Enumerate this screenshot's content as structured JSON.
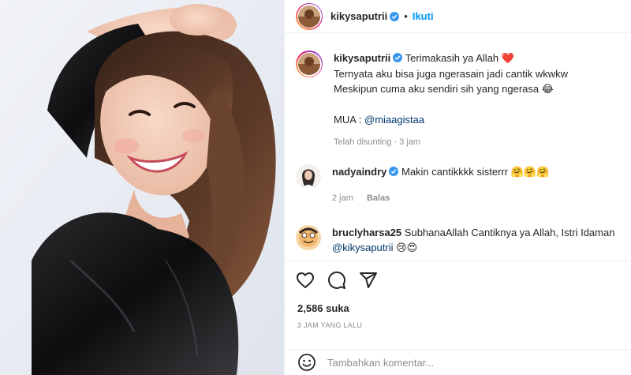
{
  "colors": {
    "accent": "#0095f6",
    "verified": "#3897f0",
    "muted": "#8e8e8e",
    "mention": "#00376b"
  },
  "photo": {
    "subject": "woman smiling in black satin top"
  },
  "header": {
    "username": "kikysaputrii",
    "separator": "•",
    "follow_label": "Ikuti"
  },
  "caption": {
    "username": "kikysaputrii",
    "line1": "Terimakasih ya Allah",
    "line1_emoji": "❤️",
    "line2": "Ternyata aku bisa juga ngerasain jadi cantik wkwkw",
    "line3": "Meskipun cuma aku sendiri sih yang ngerasa",
    "line3_emoji": "😂",
    "mua_label": "MUA :",
    "mua_mention": "@miaagistaa",
    "meta": "Telah disunting · 3 jam"
  },
  "comments": [
    {
      "username": "nadyaindry",
      "text": "Makin cantikkkk sisterrr",
      "emoji": "🤗🤗🤗",
      "time": "2 jam",
      "reply_label": "Balas"
    },
    {
      "username": "bruclyharsa25",
      "text": "SubhanaAllah Cantiknya ya Allah, Istri Idaman",
      "mention": "@kikysaputrii",
      "emoji": "😢😍"
    }
  ],
  "actions": {
    "icons": [
      "heart-icon",
      "comment-icon",
      "share-icon"
    ],
    "likes": "2,586 suka",
    "timeago": "3 JAM YANG LALU"
  },
  "add_comment": {
    "placeholder": "Tambahkan komentar..."
  }
}
